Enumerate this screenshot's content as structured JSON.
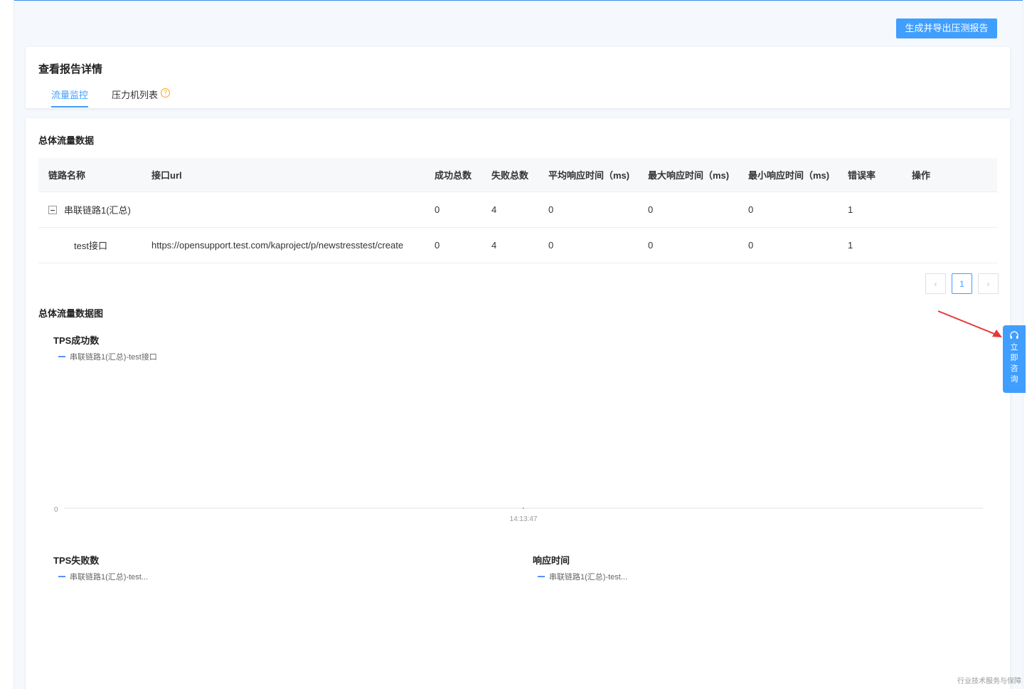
{
  "header": {
    "export_button": "生成并导出压测报告"
  },
  "report": {
    "title": "查看报告详情",
    "tabs": [
      {
        "label": "流量监控",
        "active": true
      },
      {
        "label": "压力机列表",
        "active": false,
        "help_icon": "question-circle-icon"
      }
    ]
  },
  "overall": {
    "section_title": "总体流量数据",
    "table": {
      "headers": [
        "链路名称",
        "接口url",
        "成功总数",
        "失败总数",
        "平均响应时间（ms)",
        "最大响应时间（ms)",
        "最小响应时间（ms)",
        "错误率",
        "操作"
      ],
      "rows": [
        {
          "name": "串联链路1(汇总)",
          "url": "",
          "success": "0",
          "fail": "4",
          "avg": "0",
          "max": "0",
          "min": "0",
          "error_rate": "1",
          "action": "",
          "collapsible": true
        },
        {
          "name": "test接口",
          "url": "https://opensupport.test.com/kaproject/p/newstresstest/create",
          "success": "0",
          "fail": "4",
          "avg": "0",
          "max": "0",
          "min": "0",
          "error_rate": "1",
          "action": ""
        }
      ]
    },
    "pagination": {
      "prev": "‹",
      "current": "1",
      "next": "›"
    }
  },
  "charts_section": {
    "title": "总体流量数据图",
    "tps_success": {
      "title": "TPS成功数",
      "legend": "串联链路1(汇总)-test接口",
      "y_tick": "0",
      "x_tick": "14:13:47"
    },
    "tps_fail": {
      "title": "TPS失败数",
      "legend": "串联链路1(汇总)-test..."
    },
    "response_time": {
      "title": "响应时间",
      "legend": "串联链路1(汇总)-test..."
    }
  },
  "chart_data": [
    {
      "type": "line",
      "title": "TPS成功数",
      "x": [
        "14:13:47"
      ],
      "series": [
        {
          "name": "串联链路1(汇总)-test接口",
          "values": [
            0
          ]
        }
      ],
      "y_ticks": [
        "0"
      ]
    },
    {
      "type": "line",
      "title": "TPS失败数",
      "x": [],
      "series": [
        {
          "name": "串联链路1(汇总)-test...",
          "values": []
        }
      ]
    },
    {
      "type": "line",
      "title": "响应时间",
      "x": [],
      "series": [
        {
          "name": "串联链路1(汇总)-test...",
          "values": []
        }
      ]
    }
  ],
  "consult": {
    "icon": "headset-icon",
    "chars": [
      "立",
      "即",
      "咨",
      "询"
    ]
  },
  "footer": {
    "text": "行业技术服务与保障"
  },
  "colors": {
    "primary": "#409eff",
    "legend_line": "#5b8ff9",
    "arrow": "#e53935",
    "help": "#f5a623"
  }
}
